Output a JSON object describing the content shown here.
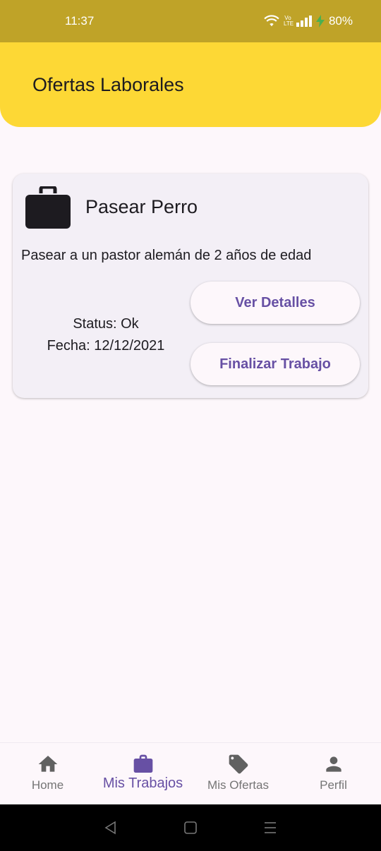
{
  "status_bar": {
    "time": "11:37",
    "network": "Vo LTE",
    "battery": "80%"
  },
  "app_bar": {
    "title": "Ofertas Laborales"
  },
  "job_card": {
    "icon": "briefcase-icon",
    "title": "Pasear Perro",
    "description": "Pasear a un pastor alemán de 2 años de edad",
    "status": "Status: Ok",
    "date": "Fecha: 12/12/2021",
    "details_button": "Ver Detalles",
    "finish_button": "Finalizar Trabajo"
  },
  "bottom_nav": {
    "items": [
      {
        "label": "Home",
        "icon": "home-icon",
        "active": false
      },
      {
        "label": "Mis Trabajos",
        "icon": "briefcase-icon",
        "active": true
      },
      {
        "label": "Mis Ofertas",
        "icon": "tag-icon",
        "active": false
      },
      {
        "label": "Perfil",
        "icon": "person-icon",
        "active": false
      }
    ]
  },
  "colors": {
    "status_bar": "#bfa328",
    "app_bar": "#fdd835",
    "accent": "#6750a4",
    "background": "#fdf7fb",
    "card": "#f3eff6"
  }
}
